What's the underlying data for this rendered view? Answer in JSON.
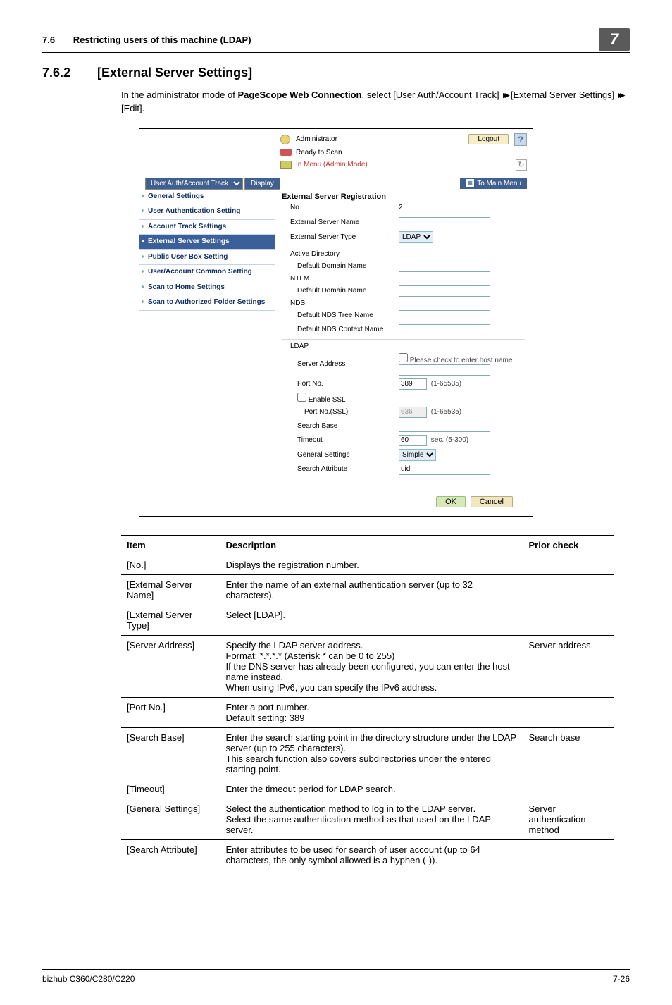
{
  "header": {
    "section_no": "7.6",
    "section_title": "Restricting users of this machine (LDAP)",
    "chapter_no": "7"
  },
  "subsection": {
    "no": "7.6.2",
    "title": "[External Server Settings]"
  },
  "intro": {
    "pre": "In the administrator mode of ",
    "bold": "PageScope Web Connection",
    "mid": ", select [User Auth/Account Track] ",
    "tail1": " [External Server Settings] ",
    "tail2": " [Edit]."
  },
  "shot": {
    "admin_label": "Administrator",
    "logout": "Logout",
    "help": "?",
    "ready": "Ready to Scan",
    "menu_link": "In Menu (Admin Mode)",
    "refresh": "↻",
    "dropdown": "User Auth/Account Track",
    "display_btn": "Display",
    "to_main": "To Main Menu",
    "side_items": [
      "General Settings",
      "User Authentication Setting",
      "Account Track Settings",
      "External Server Settings",
      "Public User Box Setting",
      "User/Account Common Setting",
      "Scan to Home Settings",
      "Scan to Authorized Folder Settings"
    ],
    "panel_title": "External Server Registration",
    "fields": {
      "no_lbl": "No.",
      "no_val": "2",
      "ext_name_lbl": "External Server Name",
      "ext_type_lbl": "External Server Type",
      "ext_type_val": "LDAP",
      "ad_lbl": "Active Directory",
      "ad_domain_lbl": "Default Domain Name",
      "ntlm_lbl": "NTLM",
      "ntlm_domain_lbl": "Default Domain Name",
      "nds_lbl": "NDS",
      "nds_tree_lbl": "Default NDS Tree Name",
      "nds_ctx_lbl": "Default NDS Context Name",
      "ldap_lbl": "LDAP",
      "srv_addr_lbl": "Server Address",
      "srv_addr_chk": "Please check to enter host name.",
      "port_lbl": "Port No.",
      "port_val": "389",
      "port_hint": "(1-65535)",
      "ssl_chk": "Enable SSL",
      "ssl_port_lbl": "Port No.(SSL)",
      "ssl_port_val": "636",
      "ssl_port_hint": "(1-65535)",
      "search_base_lbl": "Search Base",
      "timeout_lbl": "Timeout",
      "timeout_val": "60",
      "timeout_hint": "sec. (5-300)",
      "general_lbl": "General Settings",
      "general_val": "Simple",
      "attr_lbl": "Search Attribute",
      "attr_val": "uid"
    },
    "ok": "OK",
    "cancel": "Cancel"
  },
  "table": {
    "h1": "Item",
    "h2": "Description",
    "h3": "Prior check",
    "rows": [
      {
        "item": "[No.]",
        "desc": "Displays the registration number.",
        "check": ""
      },
      {
        "item": "[External Server Name]",
        "desc": "Enter the name of an external authentication server (up to 32 characters).",
        "check": ""
      },
      {
        "item": "[External Server Type]",
        "desc": "Select [LDAP].",
        "check": ""
      },
      {
        "item": "[Server Address]",
        "desc": "Specify the LDAP server address.\nFormat: *.*.*.* (Asterisk * can be 0 to 255)\nIf the DNS server has already been configured, you can enter the host name instead.\nWhen using IPv6, you can specify the IPv6 address.",
        "check": "Server address"
      },
      {
        "item": "[Port No.]",
        "desc": "Enter a port number.\nDefault setting: 389",
        "check": ""
      },
      {
        "item": "[Search Base]",
        "desc": "Enter the search starting point in the directory structure under the LDAP server (up to 255 characters).\nThis search function also covers subdirectories under the entered starting point.",
        "check": "Search base"
      },
      {
        "item": "[Timeout]",
        "desc": "Enter the timeout period for LDAP search.",
        "check": ""
      },
      {
        "item": "[General Settings]",
        "desc": "Select the authentication method to log in to the LDAP server.\nSelect the same authentication method as that used on the LDAP server.",
        "check": "Server authentication method"
      },
      {
        "item": "[Search Attribute]",
        "desc": "Enter attributes to be used for search of user account (up to 64 characters, the only symbol allowed is a hyphen (-)).",
        "check": ""
      }
    ]
  },
  "footer": {
    "model": "bizhub C360/C280/C220",
    "page": "7-26"
  }
}
